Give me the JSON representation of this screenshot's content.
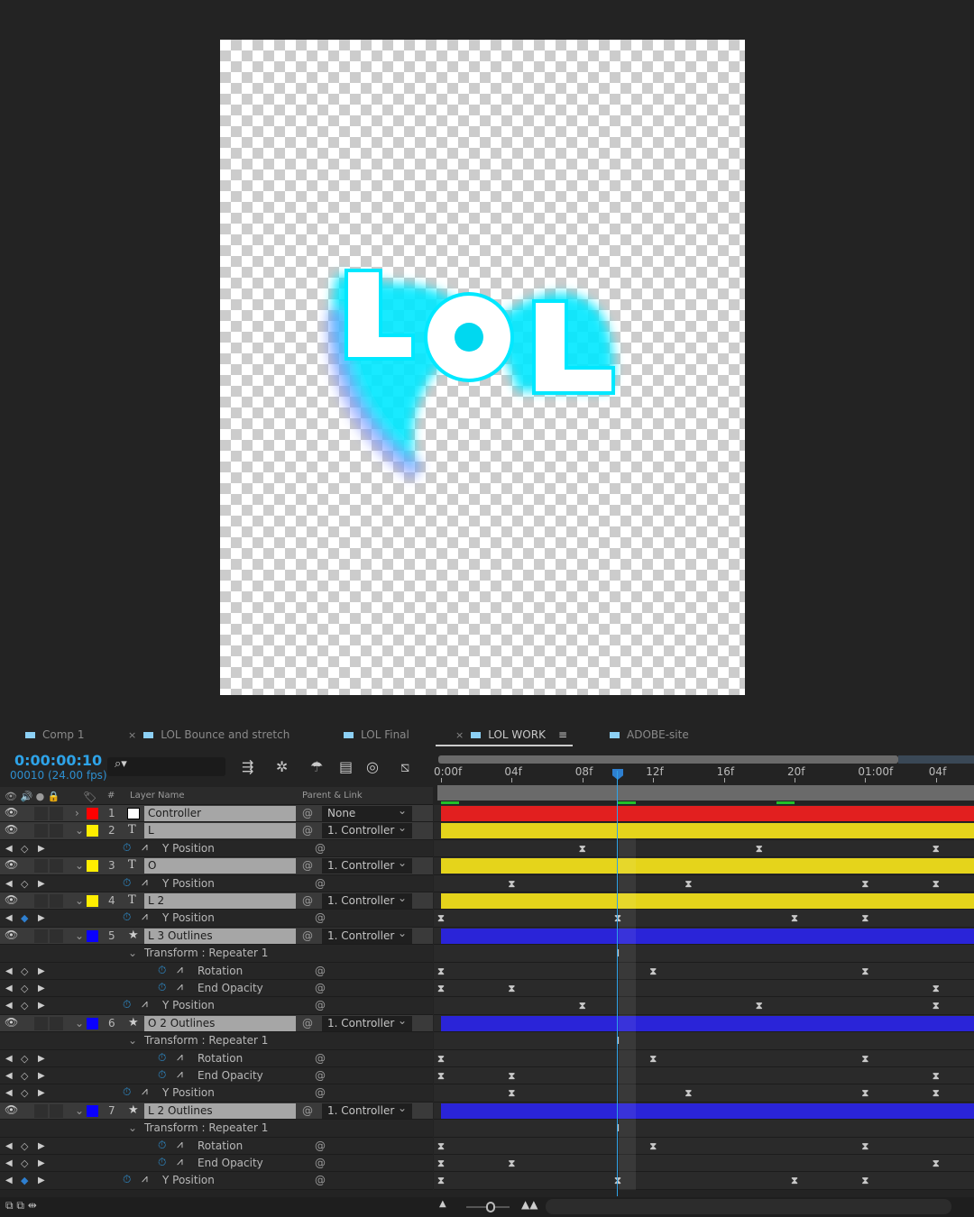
{
  "tabs": [
    {
      "label": "Comp 1",
      "close": false
    },
    {
      "label": "LOL Bounce and stretch",
      "close": true
    },
    {
      "label": "LOL Final",
      "close": false
    },
    {
      "label": "LOL WORK",
      "close": true,
      "active": true,
      "menu": "≡"
    },
    {
      "label": "ADOBE-site",
      "close": false
    }
  ],
  "timecode": "0:00:00:10",
  "frame_info": "00010 (24.00 fps)",
  "search_placeholder": "⌕▾",
  "columns": {
    "number": "#",
    "layer_name": "Layer Name",
    "parent": "Parent & Link"
  },
  "ruler_ticks": [
    {
      "label": "0:00f",
      "frame": 0
    },
    {
      "label": "04f",
      "frame": 4
    },
    {
      "label": "08f",
      "frame": 8
    },
    {
      "label": "12f",
      "frame": 12
    },
    {
      "label": "16f",
      "frame": 16
    },
    {
      "label": "20f",
      "frame": 20
    },
    {
      "label": "01:00f",
      "frame": 24
    },
    {
      "label": "04f",
      "frame": 28
    }
  ],
  "current_frame": 10,
  "colors": {
    "accent": "#2ea3e8",
    "red": "#e21f1f",
    "yellow": "#e5d41b",
    "blue": "#2a24d8"
  },
  "rows": [
    {
      "type": "layer",
      "num": "1",
      "icon": "solid",
      "name": "Controller",
      "label_color": "#ff0000",
      "parent": "None",
      "bar": "#e21f1f",
      "twirl": "›"
    },
    {
      "type": "layer",
      "num": "2",
      "icon": "T",
      "name": "L",
      "label_color": "#ffee00",
      "parent": "1. Controller",
      "bar": "#e5d41b",
      "twirl": "⌄"
    },
    {
      "type": "prop",
      "name": "Y Position",
      "indent": 0,
      "keys": [
        8,
        18,
        28
      ]
    },
    {
      "type": "layer",
      "num": "3",
      "icon": "T",
      "name": "O",
      "label_color": "#ffee00",
      "parent": "1. Controller",
      "bar": "#e5d41b",
      "twirl": "⌄"
    },
    {
      "type": "prop",
      "name": "Y Position",
      "indent": 0,
      "keys": [
        4,
        14,
        24,
        28
      ]
    },
    {
      "type": "layer",
      "num": "4",
      "icon": "T",
      "name": "L 2",
      "label_color": "#ffee00",
      "parent": "1. Controller",
      "bar": "#e5d41b",
      "twirl": "⌄"
    },
    {
      "type": "prop",
      "name": "Y Position",
      "indent": 0,
      "keys": [
        0,
        10,
        20,
        24
      ],
      "on_key": true
    },
    {
      "type": "layer",
      "num": "5",
      "icon": "★",
      "name": "L 3 Outlines",
      "label_color": "#0a00ff",
      "parent": "1. Controller",
      "bar": "#2a24d8",
      "twirl": "⌄"
    },
    {
      "type": "group",
      "name": "Transform : Repeater 1"
    },
    {
      "type": "prop",
      "name": "Rotation",
      "indent": 1,
      "keys": [
        0,
        12,
        24
      ]
    },
    {
      "type": "prop",
      "name": "End Opacity",
      "indent": 1,
      "keys": [
        0,
        4,
        28
      ]
    },
    {
      "type": "prop",
      "name": "Y Position",
      "indent": 0,
      "keys": [
        8,
        18,
        28
      ]
    },
    {
      "type": "layer",
      "num": "6",
      "icon": "★",
      "name": "O 2 Outlines",
      "label_color": "#0a00ff",
      "parent": "1. Controller",
      "bar": "#2a24d8",
      "twirl": "⌄"
    },
    {
      "type": "group",
      "name": "Transform : Repeater 1"
    },
    {
      "type": "prop",
      "name": "Rotation",
      "indent": 1,
      "keys": [
        0,
        12,
        24
      ]
    },
    {
      "type": "prop",
      "name": "End Opacity",
      "indent": 1,
      "keys": [
        0,
        4,
        28
      ]
    },
    {
      "type": "prop",
      "name": "Y Position",
      "indent": 0,
      "keys": [
        4,
        14,
        24,
        28
      ]
    },
    {
      "type": "layer",
      "num": "7",
      "icon": "★",
      "name": "L 2 Outlines",
      "label_color": "#0a00ff",
      "parent": "1. Controller",
      "bar": "#2a24d8",
      "twirl": "⌄"
    },
    {
      "type": "group",
      "name": "Transform : Repeater 1"
    },
    {
      "type": "prop",
      "name": "Rotation",
      "indent": 1,
      "keys": [
        0,
        12,
        24
      ]
    },
    {
      "type": "prop",
      "name": "End Opacity",
      "indent": 1,
      "keys": [
        0,
        4,
        28
      ]
    },
    {
      "type": "prop",
      "name": "Y Position",
      "indent": 0,
      "keys": [
        0,
        10,
        20,
        24
      ],
      "on_key": true
    }
  ]
}
